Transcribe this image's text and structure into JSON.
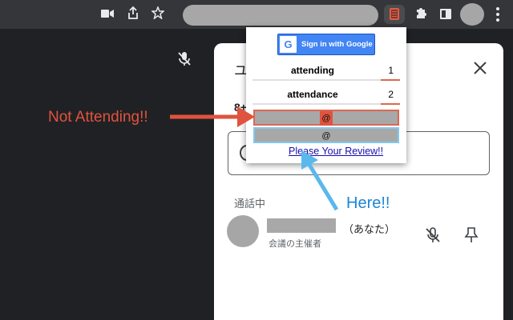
{
  "toolbar": {
    "icons": [
      "video-camera-icon",
      "share-icon",
      "star-icon",
      "extension-book-icon",
      "puzzle-icon",
      "side-panel-icon",
      "profile-avatar",
      "kebab-menu-icon"
    ]
  },
  "panel": {
    "title": "ユ",
    "partial_text": "8+",
    "section_label": "通話中",
    "participant": {
      "you_label": "（あなた）",
      "role": "会議の主催者"
    }
  },
  "popup": {
    "signin_label": "Sign in with Google",
    "google_letter": "G",
    "rows": [
      {
        "label": "attending",
        "count": "1"
      },
      {
        "label": "attendance",
        "count": "2"
      }
    ],
    "entry_red": "@",
    "entry_blue": "@",
    "review_link": "Please Your Review!!"
  },
  "annotations": {
    "not_attending": "Not Attending!!",
    "here": "Here!!",
    "red_color": "#e0533e",
    "blue_color": "#1b86d6"
  }
}
